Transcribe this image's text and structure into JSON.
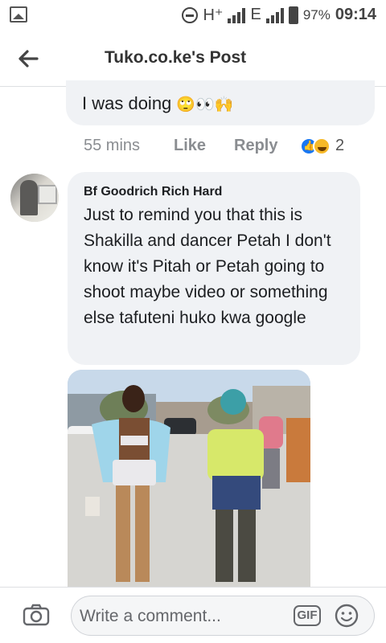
{
  "status_bar": {
    "network_1": "H⁺",
    "network_2": "E",
    "battery": "97%",
    "time": "09:14"
  },
  "header": {
    "title": "Tuko.co.ke's Post"
  },
  "previous_comment": {
    "text_tail": "I was doing",
    "emojis": "🙄👀🙌",
    "time": "55 mins",
    "like_label": "Like",
    "reply_label": "Reply",
    "reaction_count": "2",
    "reactions": [
      "like-reaction-icon",
      "haha-reaction-icon"
    ]
  },
  "comment": {
    "author": "Bf Goodrich Rich Hard",
    "text": "Just to remind you that this is Shakilla and dancer Petah I don't know it's Pitah or Petah going to shoot maybe video or something else tafuteni huko kwa google"
  },
  "composer": {
    "placeholder": "Write a comment...",
    "gif_label": "GIF"
  }
}
